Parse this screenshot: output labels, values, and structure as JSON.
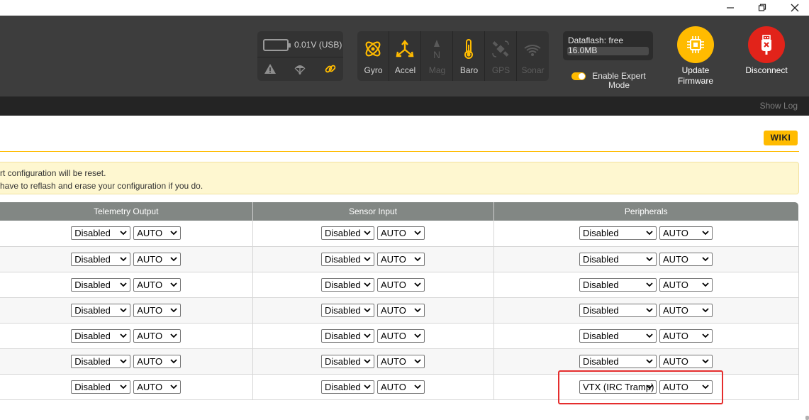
{
  "header": {
    "voltage": "0.01V (USB)",
    "sensors": [
      {
        "label": "Gyro",
        "icon": "gyro-icon",
        "active": true
      },
      {
        "label": "Accel",
        "icon": "accel-icon",
        "active": true
      },
      {
        "label": "Mag",
        "icon": "mag-icon",
        "active": false
      },
      {
        "label": "Baro",
        "icon": "baro-icon",
        "active": true
      },
      {
        "label": "GPS",
        "icon": "gps-icon",
        "active": false
      },
      {
        "label": "Sonar",
        "icon": "sonar-icon",
        "active": false
      }
    ],
    "dataflash_label": "Dataflash: free",
    "dataflash_value": "16.0MB",
    "expert_mode_label": "Enable Expert Mode",
    "update_firmware_label": "Update Firmware",
    "disconnect_label": "Disconnect",
    "show_log_label": "Show Log",
    "colors": {
      "accent": "#ffbb00",
      "disconnect": "#e2231a",
      "header_bg": "#3d3d3d"
    }
  },
  "wiki_label": "WIKI",
  "notice": {
    "line1": "rt configuration will be reset.",
    "line2": "have to reflash and erase your configuration if you do."
  },
  "table": {
    "headers": [
      "Telemetry Output",
      "Sensor Input",
      "Peripherals"
    ],
    "rows": [
      {
        "telemetry": "Disabled",
        "telemetry_baud": "AUTO",
        "sensor": "Disabled",
        "sensor_baud": "AUTO",
        "peripheral": "Disabled",
        "peripheral_baud": "AUTO"
      },
      {
        "telemetry": "Disabled",
        "telemetry_baud": "AUTO",
        "sensor": "Disabled",
        "sensor_baud": "AUTO",
        "peripheral": "Disabled",
        "peripheral_baud": "AUTO"
      },
      {
        "telemetry": "Disabled",
        "telemetry_baud": "AUTO",
        "sensor": "Disabled",
        "sensor_baud": "AUTO",
        "peripheral": "Disabled",
        "peripheral_baud": "AUTO"
      },
      {
        "telemetry": "Disabled",
        "telemetry_baud": "AUTO",
        "sensor": "Disabled",
        "sensor_baud": "AUTO",
        "peripheral": "Disabled",
        "peripheral_baud": "AUTO"
      },
      {
        "telemetry": "Disabled",
        "telemetry_baud": "AUTO",
        "sensor": "Disabled",
        "sensor_baud": "AUTO",
        "peripheral": "Disabled",
        "peripheral_baud": "AUTO"
      },
      {
        "telemetry": "Disabled",
        "telemetry_baud": "AUTO",
        "sensor": "Disabled",
        "sensor_baud": "AUTO",
        "peripheral": "Disabled",
        "peripheral_baud": "AUTO"
      },
      {
        "telemetry": "Disabled",
        "telemetry_baud": "AUTO",
        "sensor": "Disabled",
        "sensor_baud": "AUTO",
        "peripheral": "VTX (IRC Tramp)",
        "peripheral_baud": "AUTO"
      }
    ]
  }
}
